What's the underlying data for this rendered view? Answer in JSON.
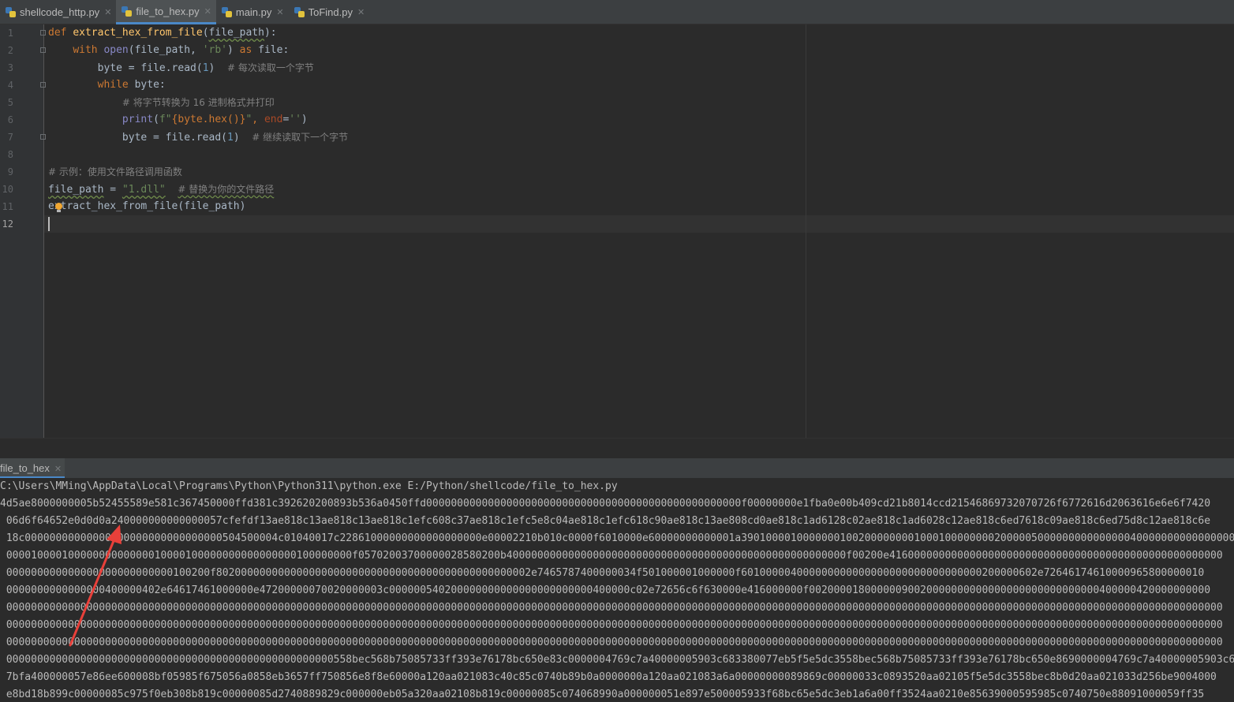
{
  "tabs": [
    {
      "label": "shellcode_http.py",
      "active": false
    },
    {
      "label": "file_to_hex.py",
      "active": true
    },
    {
      "label": "main.py",
      "active": false
    },
    {
      "label": "ToFind.py",
      "active": false
    }
  ],
  "gutter": {
    "line_numbers": [
      "1",
      "2",
      "3",
      "4",
      "5",
      "6",
      "7",
      "8",
      "9",
      "10",
      "11",
      "12"
    ],
    "current_line": "12"
  },
  "code": {
    "l1": {
      "kw_def": "def",
      "func_name": "extract_hex_from_file",
      "open_paren": "(",
      "param": "file_path",
      "close": "):"
    },
    "l2": {
      "kw_with": "with",
      "builtin_open": "open",
      "args_a": "(file_path, ",
      "str_rb": "'rb'",
      "args_b": ") ",
      "kw_as": "as",
      "tail": " file:"
    },
    "l3": {
      "lhs": "byte = file.read(",
      "num": "1",
      "rp": ")",
      "comment": "# 每次读取一个字节"
    },
    "l4": {
      "kw_while": "while",
      "tail": " byte:"
    },
    "l5": {
      "comment": "# 将字节转换为 16 进制格式并打印"
    },
    "l6": {
      "builtin_print": "print",
      "lp": "(",
      "fprefix": "f\"",
      "expr": "{byte.hex()}",
      "fend": "\"",
      "comma": ", ",
      "kwarg": "end",
      "eq": "=",
      "empty_str": "''",
      "rp": ")"
    },
    "l7": {
      "lhs": "byte = file.read(",
      "num": "1",
      "rp": ")",
      "comment": "# 继续读取下一个字节"
    },
    "l9": {
      "comment": "# 示例：使用文件路径调用函数"
    },
    "l10": {
      "var": "file_path",
      "eq": " = ",
      "str": "\"1.dll\"",
      "comment": "# 替换为你的文件路径"
    },
    "l11": {
      "call": "extract_hex_from_file(file_path)"
    }
  },
  "run": {
    "tab_label": "file_to_hex",
    "lines": [
      "C:\\Users\\MMing\\AppData\\Local\\Programs\\Python\\Python311\\python.exe E:/Python/shellcode/file_to_hex.py",
      "4d5ae8000000005b52455589e581c367450000ffd381c392620200893b536a0450ffd000000000000000000000000000000000000000000000000000f00000000e1fba0e00b409cd21b8014ccd21546869732070726f6772616d2063616e6e6f7420",
      " 06d6f64652e0d0d0a240000000000000057cfefdf13ae818c13ae818c13ae818c1efc608c37ae818c1efc5e8c04ae818c1efc618c90ae818c13ae808cd0ae818c1ad6128c02ae818c1ad6028c12ae818c6ed7618c09ae818c6ed75d8c12ae818c6e",
      " 18c00000000000000000000000000000000504500004c01040017c22861000000000000000000e00002210b010c0000f6010000e60000000000001a39010000100000001002000000001000100000000200000500000000000000040000000000000000",
      " 00001000010000000000000010000100000000000000000100000000f05702003700000028580200b4000000000000000000000000000000000000000000000000000000f00200e416000000000000000000000000000000000000000000000000000",
      " 000000000000000000000000000100200f802000000000000000000000000000000000000000000000002e7465787400000034f501000001000000f601000004000000000000000000000000000000200000602e72646174610000965800000010",
      " 0000000000000000400000402e64617461000000e47200000070020000003c000000540200000000000000000000000400000c02e72656c6f630000e416000000f00200001800000090020000000000000000000000000000400000420000000000",
      " 00000000000000000000000000000000000000000000000000000000000000000000000000000000000000000000000000000000000000000000000000000000000000000000000000000000000000000000000000000000000000000000000000000",
      " 00000000000000000000000000000000000000000000000000000000000000000000000000000000000000000000000000000000000000000000000000000000000000000000000000000000000000000000000000000000000000000000000000000",
      " 00000000000000000000000000000000000000000000000000000000000000000000000000000000000000000000000000000000000000000000000000000000000000000000000000000000000000000000000000000000000000000000000000000",
      " 00000000000000000000000000000000000000000000000000000558bec568b75085733ff393e76178bc650e83c0000004769c7a40000005903c683380077eb5f5e5dc3558bec568b75085733ff393e76178bc650e8690000004769c7a40000005903c6",
      " 7bfa400000057e86ee600008bf05985f675056a0858eb3657ff750856e8f8e60000a120aa021083c40c85c0740b89b0a0000000a120aa021083a6a00000000089869c00000033c0893520aa02105f5e5dc3558bec8b0d20aa021033d256be9004000",
      " e8bd18b899c00000085c975f0eb308b819c00000085d2740889829c000000eb05a320aa02108b819c00000085c074068990a000000051e897e500005933f68bc65e5dc3eb1a6a00ff3524aa0210e85639000595985c0740750e88091000059ff35"
    ]
  },
  "colors": {
    "background": "#2b2b2b",
    "gutter": "#313335",
    "keyword": "#cc7832",
    "function": "#ffc66d",
    "builtin": "#8888c6",
    "string": "#6a8759",
    "number": "#6897bb",
    "comment": "#808080",
    "annotation_arrow": "#e8403a"
  },
  "icons": [
    "python-file-icon",
    "close-icon",
    "fold-marker-icon",
    "intention-bulb-icon",
    "annotation-arrow"
  ]
}
